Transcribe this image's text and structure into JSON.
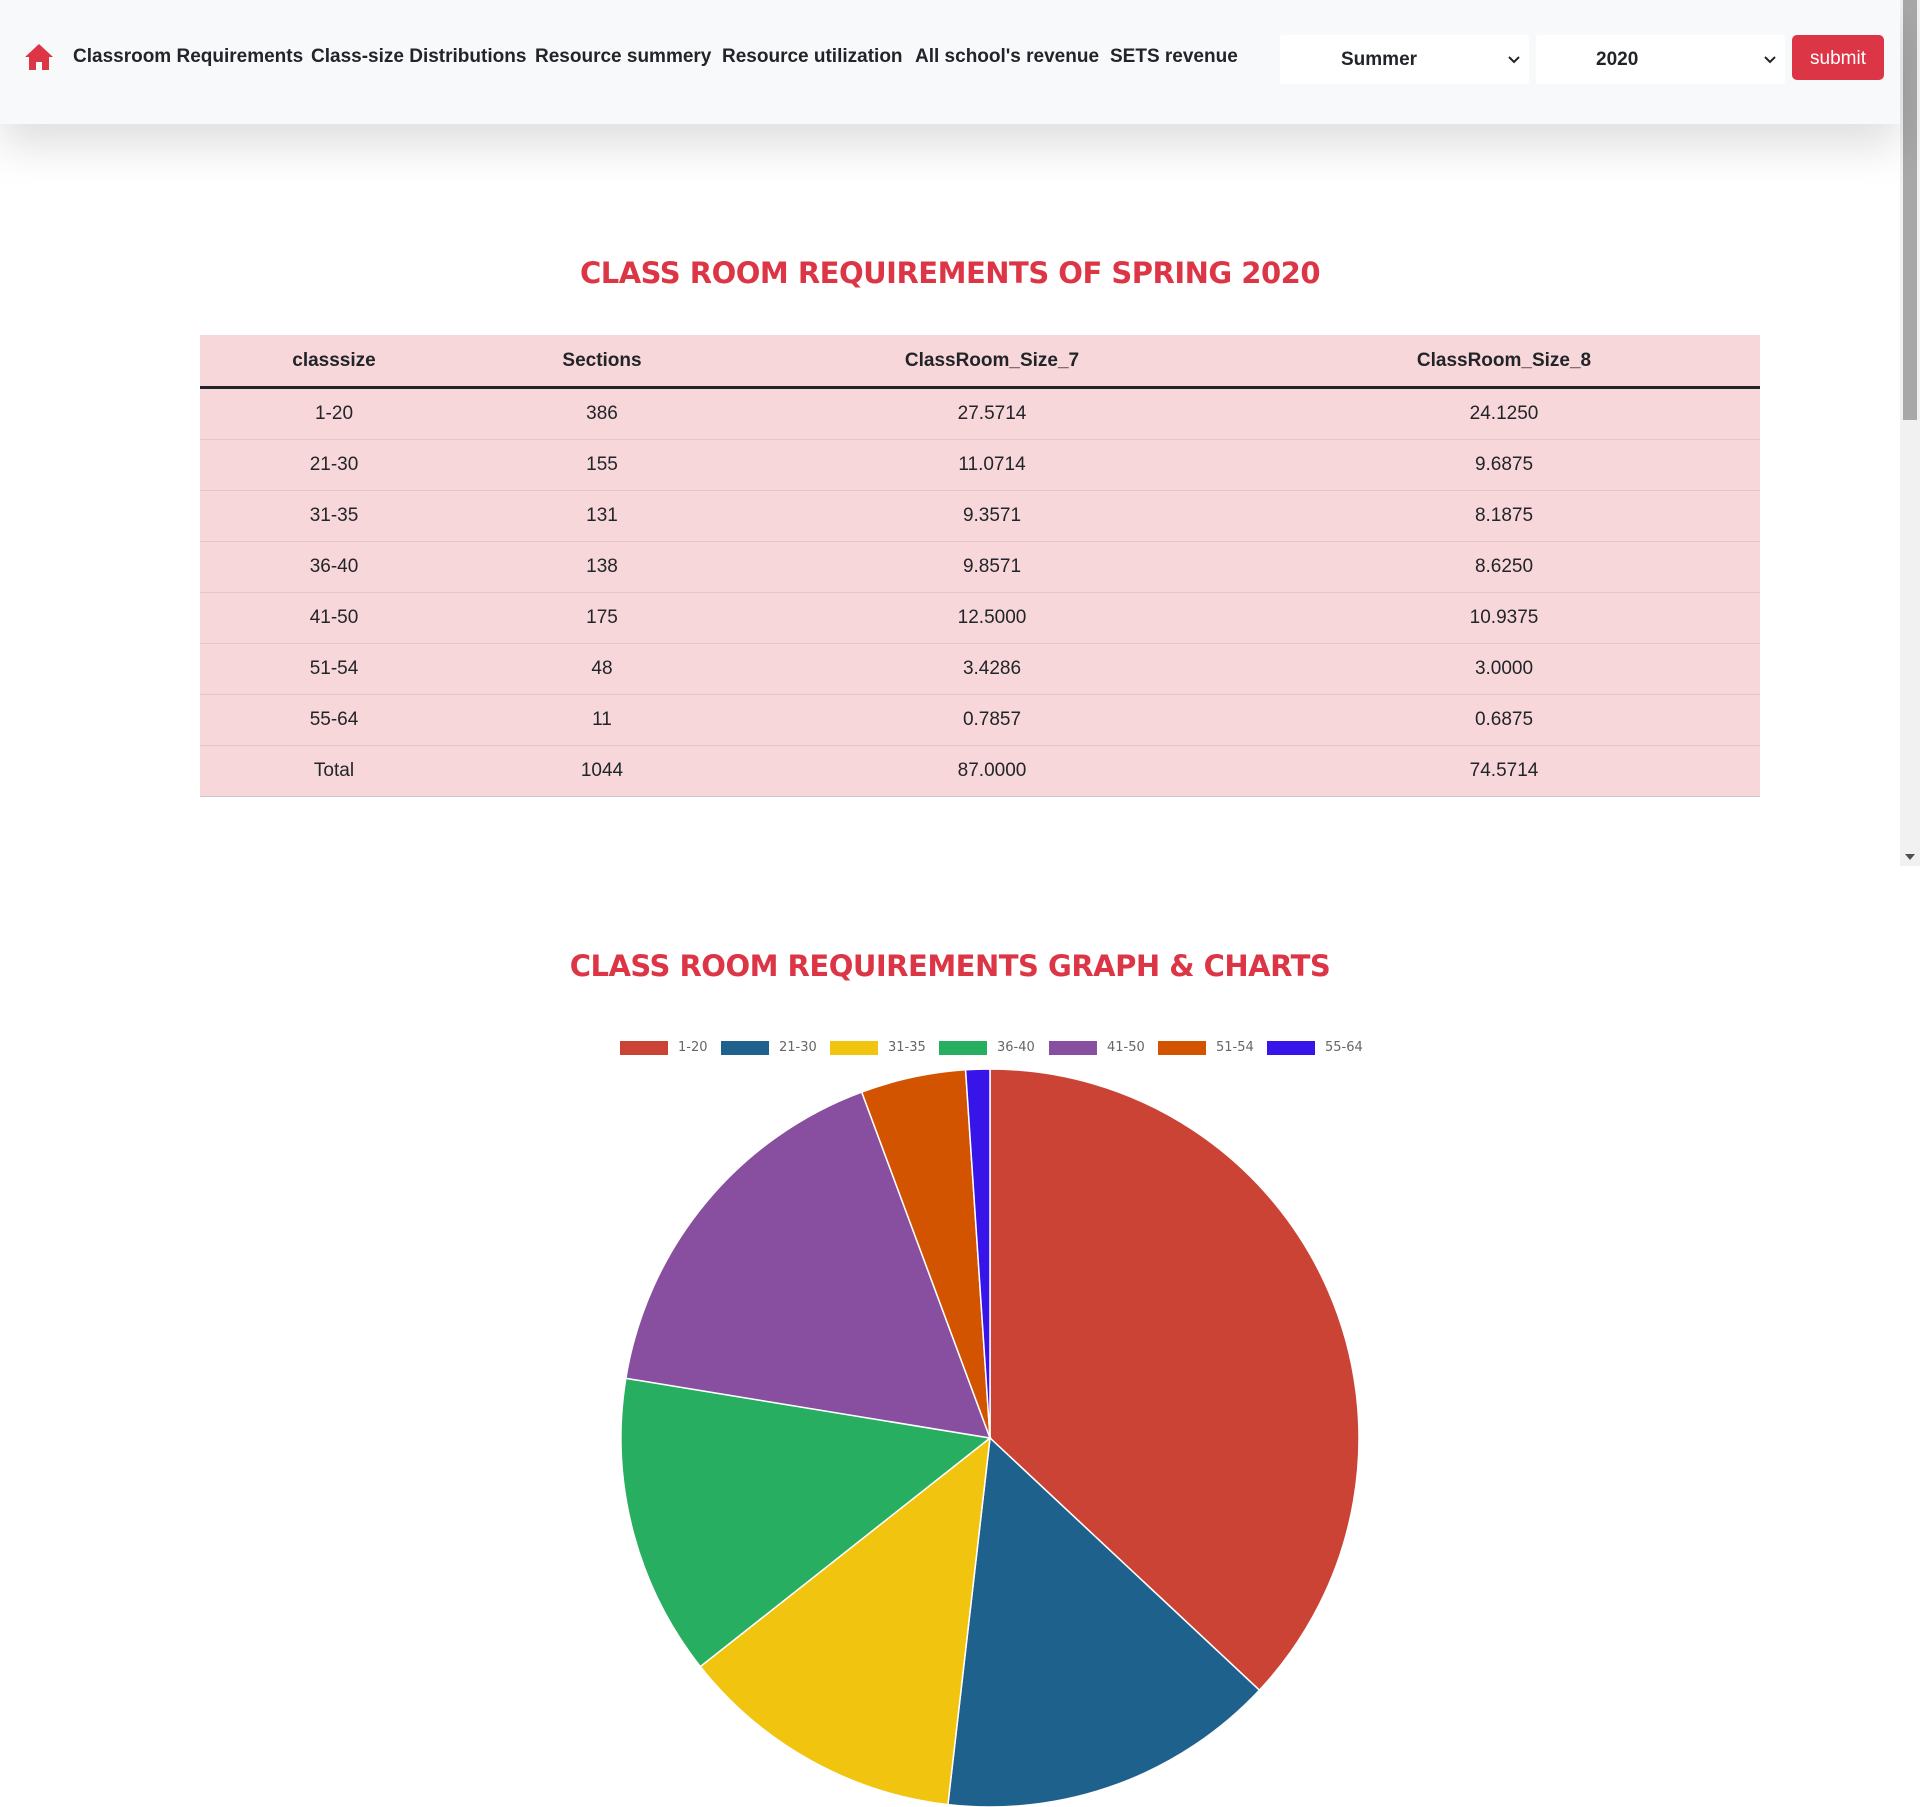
{
  "nav": {
    "links": [
      "Classroom Requirements",
      "Class-size Distributions",
      "Resource summery",
      "Resource utilization",
      "All school's revenue",
      "SETS revenue"
    ],
    "semester_select": "Summer",
    "year_select": "2020",
    "submit_label": "submit",
    "accent_color": "#dc3545"
  },
  "table_section": {
    "title": "CLASS ROOM REQUIREMENTS OF SPRING 2020",
    "headers": [
      "classsize",
      "Sections",
      "ClassRoom_Size_7",
      "ClassRoom_Size_8"
    ],
    "rows": [
      [
        "1-20",
        "386",
        "27.5714",
        "24.1250"
      ],
      [
        "21-30",
        "155",
        "11.0714",
        "9.6875"
      ],
      [
        "31-35",
        "131",
        "9.3571",
        "8.1875"
      ],
      [
        "36-40",
        "138",
        "9.8571",
        "8.6250"
      ],
      [
        "41-50",
        "175",
        "12.5000",
        "10.9375"
      ],
      [
        "51-54",
        "48",
        "3.4286",
        "3.0000"
      ],
      [
        "55-64",
        "11",
        "0.7857",
        "0.6875"
      ],
      [
        "Total",
        "1044",
        "87.0000",
        "74.5714"
      ]
    ],
    "row_background": "#f8d7da"
  },
  "chart_section": {
    "title": "CLASS ROOM REQUIREMENTS GRAPH & CHARTS"
  },
  "chart_data": {
    "type": "pie",
    "categories": [
      "1-20",
      "21-30",
      "31-35",
      "36-40",
      "41-50",
      "51-54",
      "55-64"
    ],
    "values": [
      386,
      155,
      131,
      138,
      175,
      48,
      11
    ],
    "colors": [
      "#cb4335",
      "#1f618d",
      "#f1c40f",
      "#27ae60",
      "#884ea0",
      "#d35400",
      "#3714e8"
    ],
    "legend_position": "top"
  }
}
